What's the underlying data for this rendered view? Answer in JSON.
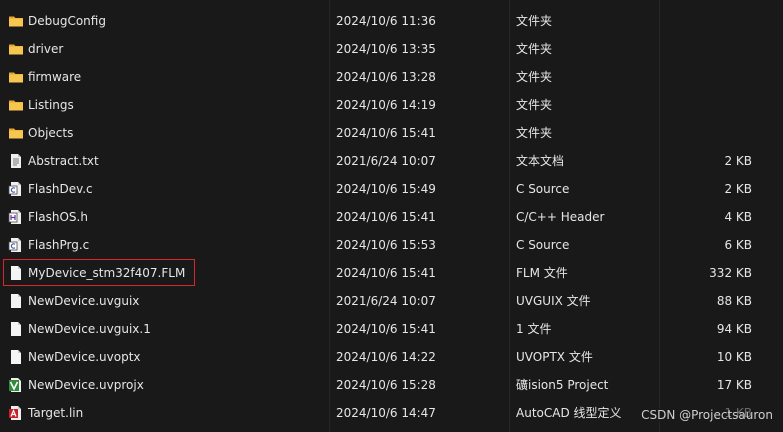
{
  "files": [
    {
      "name": "DebugConfig",
      "date": "2024/10/6 11:36",
      "type": "文件夹",
      "size": "",
      "icon": "folder-icon"
    },
    {
      "name": "driver",
      "date": "2024/10/6 13:35",
      "type": "文件夹",
      "size": "",
      "icon": "folder-icon"
    },
    {
      "name": "firmware",
      "date": "2024/10/6 13:28",
      "type": "文件夹",
      "size": "",
      "icon": "folder-icon"
    },
    {
      "name": "Listings",
      "date": "2024/10/6 14:19",
      "type": "文件夹",
      "size": "",
      "icon": "folder-icon"
    },
    {
      "name": "Objects",
      "date": "2024/10/6 15:41",
      "type": "文件夹",
      "size": "",
      "icon": "folder-icon"
    },
    {
      "name": "Abstract.txt",
      "date": "2021/6/24 10:07",
      "type": "文本文档",
      "size": "2 KB",
      "icon": "text-file-icon"
    },
    {
      "name": "FlashDev.c",
      "date": "2024/10/6 15:49",
      "type": "C Source",
      "size": "2 KB",
      "icon": "c-source-file-icon"
    },
    {
      "name": "FlashOS.h",
      "date": "2024/10/6 15:41",
      "type": "C/C++ Header",
      "size": "4 KB",
      "icon": "header-file-icon"
    },
    {
      "name": "FlashPrg.c",
      "date": "2024/10/6 15:53",
      "type": "C Source",
      "size": "6 KB",
      "icon": "c-source-file-icon"
    },
    {
      "name": "MyDevice_stm32f407.FLM",
      "date": "2024/10/6 15:41",
      "type": "FLM 文件",
      "size": "332 KB",
      "icon": "blank-file-icon"
    },
    {
      "name": "NewDevice.uvguix",
      "date": "2021/6/24 10:07",
      "type": "UVGUIX 文件",
      "size": "88 KB",
      "icon": "blank-file-icon"
    },
    {
      "name": "NewDevice.uvguix.1",
      "date": "2024/10/6 15:41",
      "type": "1 文件",
      "size": "94 KB",
      "icon": "blank-file-icon"
    },
    {
      "name": "NewDevice.uvoptx",
      "date": "2024/10/6 14:22",
      "type": "UVOPTX 文件",
      "size": "10 KB",
      "icon": "blank-file-icon"
    },
    {
      "name": "NewDevice.uvprojx",
      "date": "2024/10/6 15:28",
      "type": "礦ision5 Project",
      "size": "17 KB",
      "icon": "uvision-project-icon"
    },
    {
      "name": "Target.lin",
      "date": "2024/10/6 14:47",
      "type": "AutoCAD 线型定义",
      "size": "1 KB",
      "icon": "autocad-file-icon"
    }
  ],
  "watermark": "CSDN @Projectsauron",
  "colors": {
    "background": "#191919",
    "text": "#e6e6e6",
    "folder": "#f2c14e",
    "highlight_border": "#d8262a"
  }
}
